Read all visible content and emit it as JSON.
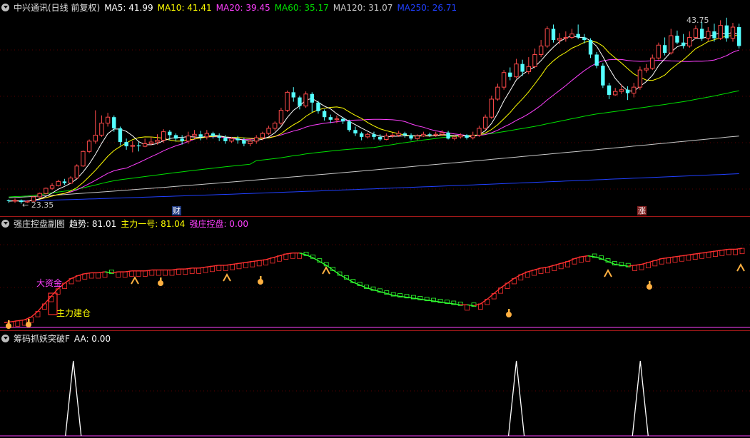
{
  "colors": {
    "up": "#ff4a4a",
    "down": "#54ffff",
    "ma5": "#ffffff",
    "ma10": "#ffff00",
    "ma20": "#ff40ff",
    "ma60": "#00e000",
    "ma120": "#c8c8c8",
    "ma250": "#2040ff",
    "grid": "#5a0000"
  },
  "main": {
    "title": "中兴通讯(日线 前复权)",
    "ma5": "MA5: 41.99",
    "ma10": "MA10: 41.41",
    "ma20": "MA20: 39.45",
    "ma60": "MA60: 35.17",
    "ma120": "MA120: 31.07",
    "ma250": "MA250: 26.71",
    "high_label": "43.75",
    "low_label": "← 23.35",
    "marker_cai": "财",
    "marker_zhang": "涨"
  },
  "sub1": {
    "title": "强庄控盘副图",
    "trend": "趋势: 81.01",
    "main1": "主力一号: 81.04",
    "control": "强庄控盘: 0.00",
    "big_funds": "大资金",
    "build": "主力建仓"
  },
  "sub2": {
    "title": "筹码抓妖突破F",
    "aa": "AA: 0.00"
  },
  "chart_data": [
    {
      "type": "candlestick",
      "title": "中兴通讯(日线 前复权)",
      "candles": [
        [
          23.6,
          23.5,
          23.7,
          23.3
        ],
        [
          23.5,
          23.6,
          23.8,
          23.3
        ],
        [
          23.6,
          23.4,
          23.7,
          23.2
        ],
        [
          23.4,
          23.5,
          23.6,
          23.3
        ],
        [
          23.5,
          24.0,
          24.1,
          23.4
        ],
        [
          24.0,
          24.4,
          24.5,
          23.9
        ],
        [
          24.4,
          25.0,
          25.1,
          24.3
        ],
        [
          25.0,
          25.3,
          25.6,
          24.8
        ],
        [
          25.3,
          25.8,
          26.0,
          25.2
        ],
        [
          25.8,
          25.6,
          26.1,
          25.4
        ],
        [
          25.6,
          26.2,
          26.4,
          25.5
        ],
        [
          26.2,
          27.6,
          27.8,
          26.1
        ],
        [
          27.6,
          29.3,
          29.4,
          27.5
        ],
        [
          29.3,
          30.5,
          30.7,
          29.1
        ],
        [
          30.5,
          31.2,
          34.1,
          30.2
        ],
        [
          31.2,
          32.6,
          33.5,
          31.0
        ],
        [
          32.6,
          33.3,
          33.8,
          32.2
        ],
        [
          33.3,
          32.0,
          33.5,
          31.6
        ],
        [
          32.0,
          30.4,
          32.2,
          30.0
        ],
        [
          30.4,
          29.9,
          30.8,
          29.5
        ],
        [
          29.9,
          30.0,
          30.5,
          29.2
        ],
        [
          30.0,
          29.9,
          30.4,
          29.3
        ],
        [
          29.9,
          30.2,
          30.8,
          29.8
        ],
        [
          30.2,
          30.4,
          31.0,
          30.0
        ],
        [
          30.4,
          30.6,
          31.3,
          30.1
        ],
        [
          30.6,
          31.6,
          31.9,
          30.3
        ],
        [
          31.6,
          31.2,
          31.8,
          30.6
        ],
        [
          31.2,
          30.8,
          31.4,
          30.5
        ],
        [
          30.8,
          30.5,
          31.2,
          30.1
        ],
        [
          30.5,
          31.1,
          31.6,
          30.2
        ],
        [
          31.1,
          31.3,
          31.8,
          30.8
        ],
        [
          31.3,
          31.0,
          31.7,
          30.6
        ],
        [
          31.0,
          31.4,
          31.8,
          30.7
        ],
        [
          31.4,
          31.1,
          31.6,
          30.8
        ],
        [
          31.1,
          30.9,
          31.4,
          30.5
        ],
        [
          30.9,
          30.5,
          31.2,
          30.2
        ],
        [
          30.5,
          30.8,
          31.0,
          30.3
        ],
        [
          30.8,
          30.6,
          31.1,
          30.2
        ],
        [
          30.6,
          30.2,
          30.9,
          29.9
        ],
        [
          30.2,
          30.5,
          30.8,
          29.9
        ],
        [
          30.5,
          30.9,
          31.2,
          30.2
        ],
        [
          30.9,
          31.4,
          31.6,
          30.6
        ],
        [
          31.4,
          32.0,
          32.3,
          31.2
        ],
        [
          32.0,
          32.6,
          32.8,
          31.7
        ],
        [
          32.6,
          34.1,
          34.4,
          32.4
        ],
        [
          34.1,
          36.2,
          36.4,
          33.9
        ],
        [
          36.2,
          35.6,
          36.8,
          35.1
        ],
        [
          35.6,
          34.6,
          35.8,
          34.2
        ],
        [
          34.6,
          36.0,
          36.3,
          34.4
        ],
        [
          36.0,
          35.0,
          36.2,
          33.9
        ],
        [
          35.0,
          34.0,
          35.2,
          33.7
        ],
        [
          34.0,
          33.3,
          34.2,
          32.9
        ],
        [
          33.3,
          33.0,
          33.6,
          32.6
        ],
        [
          33.0,
          33.1,
          33.5,
          32.6
        ],
        [
          33.1,
          32.8,
          33.3,
          32.5
        ],
        [
          32.8,
          31.8,
          33.0,
          31.6
        ],
        [
          31.8,
          31.4,
          32.2,
          31.1
        ],
        [
          31.4,
          31.0,
          31.6,
          30.6
        ],
        [
          31.0,
          31.3,
          31.5,
          30.8
        ],
        [
          31.3,
          31.0,
          31.6,
          30.7
        ],
        [
          31.0,
          30.7,
          31.3,
          30.5
        ],
        [
          30.7,
          31.1,
          31.4,
          30.6
        ],
        [
          31.1,
          31.2,
          31.5,
          30.9
        ],
        [
          31.2,
          31.4,
          31.7,
          31.0
        ],
        [
          31.4,
          31.2,
          31.6,
          30.9
        ],
        [
          31.2,
          30.8,
          31.4,
          30.6
        ],
        [
          30.8,
          31.1,
          31.3,
          30.6
        ],
        [
          31.1,
          31.3,
          31.6,
          31.0
        ],
        [
          31.3,
          31.2,
          31.5,
          31.0
        ],
        [
          31.2,
          31.3,
          31.6,
          31.0
        ],
        [
          31.3,
          31.5,
          31.8,
          31.1
        ],
        [
          31.5,
          30.8,
          31.7,
          30.7
        ],
        [
          30.8,
          31.0,
          31.2,
          30.6
        ],
        [
          31.0,
          31.2,
          31.4,
          30.8
        ],
        [
          31.2,
          30.9,
          31.3,
          30.7
        ],
        [
          30.9,
          31.2,
          31.6,
          30.7
        ],
        [
          31.2,
          32.0,
          32.3,
          31.0
        ],
        [
          32.0,
          33.3,
          33.6,
          31.8
        ],
        [
          33.3,
          35.4,
          35.8,
          33.1
        ],
        [
          35.4,
          36.8,
          37.2,
          35.2
        ],
        [
          36.8,
          38.5,
          38.8,
          36.5
        ],
        [
          38.5,
          38.0,
          39.1,
          37.6
        ],
        [
          38.0,
          39.5,
          40.1,
          37.8
        ],
        [
          39.5,
          38.6,
          40.0,
          38.1
        ],
        [
          38.6,
          39.2,
          40.3,
          38.3
        ],
        [
          39.2,
          40.6,
          41.3,
          39.0
        ],
        [
          40.6,
          41.6,
          42.3,
          40.3
        ],
        [
          41.6,
          43.6,
          43.9,
          41.4
        ],
        [
          43.6,
          42.3,
          44.1,
          42.0
        ],
        [
          42.3,
          42.5,
          43.1,
          41.8
        ],
        [
          42.5,
          42.6,
          43.3,
          42.1
        ],
        [
          42.6,
          43.0,
          43.6,
          42.4
        ],
        [
          43.0,
          42.6,
          44.1,
          42.4
        ],
        [
          42.6,
          42.3,
          43.0,
          41.9
        ],
        [
          42.3,
          40.6,
          42.5,
          40.2
        ],
        [
          40.6,
          39.3,
          40.9,
          39.0
        ],
        [
          39.3,
          37.0,
          39.6,
          36.7
        ],
        [
          37.0,
          35.9,
          37.3,
          35.4
        ],
        [
          35.9,
          36.3,
          36.7,
          35.8
        ],
        [
          36.3,
          36.5,
          37.1,
          36.0
        ],
        [
          36.5,
          36.1,
          36.9,
          35.3
        ],
        [
          36.1,
          36.8,
          37.3,
          35.6
        ],
        [
          36.8,
          38.8,
          39.2,
          36.5
        ],
        [
          38.8,
          39.0,
          39.5,
          38.5
        ],
        [
          39.0,
          40.2,
          40.6,
          38.8
        ],
        [
          40.2,
          41.7,
          42.0,
          40.0
        ],
        [
          41.7,
          40.8,
          42.6,
          40.5
        ],
        [
          40.8,
          42.8,
          43.6,
          40.6
        ],
        [
          42.8,
          42.0,
          43.4,
          41.8
        ],
        [
          42.0,
          41.6,
          43.0,
          41.3
        ],
        [
          41.6,
          42.6,
          43.3,
          41.4
        ],
        [
          42.6,
          43.6,
          44.0,
          42.4
        ],
        [
          43.6,
          42.5,
          44.4,
          42.2
        ],
        [
          42.5,
          43.3,
          43.8,
          42.2
        ],
        [
          43.3,
          42.5,
          44.2,
          42.1
        ],
        [
          42.5,
          44.0,
          44.6,
          42.3
        ],
        [
          44.0,
          42.5,
          44.9,
          42.1
        ],
        [
          42.5,
          43.8,
          44.3,
          42.1
        ],
        [
          43.8,
          41.6,
          44.2,
          41.3
        ]
      ],
      "ylim": [
        23.0,
        45.3
      ]
    },
    {
      "type": "line",
      "title": "强庄控盘副图",
      "series": [
        {
          "name": "主力一号",
          "values": [
            2,
            3,
            4,
            5,
            8,
            14,
            22,
            30,
            38,
            44,
            49,
            52,
            54,
            55,
            55,
            56,
            55,
            56,
            56,
            57,
            57,
            57,
            58,
            58,
            58,
            58,
            59,
            59,
            60,
            60,
            61,
            62,
            63,
            63,
            64,
            65,
            66,
            67,
            68,
            69,
            71,
            73,
            75,
            76,
            76,
            74,
            71,
            67,
            63,
            58,
            53,
            49,
            45,
            42,
            39,
            37,
            35,
            33,
            31,
            30,
            29,
            28,
            27,
            26,
            25,
            24,
            23,
            22,
            21,
            21,
            20,
            22,
            27,
            33,
            39,
            44,
            49,
            53,
            56,
            58,
            60,
            61,
            63,
            65,
            67,
            70,
            72,
            73,
            72,
            70,
            67,
            64,
            63,
            62,
            63,
            64,
            66,
            68,
            70,
            71,
            72,
            73,
            74,
            75,
            76,
            77,
            78,
            79,
            80,
            80,
            81
          ]
        }
      ],
      "ylim": [
        0,
        100
      ]
    },
    {
      "type": "line",
      "title": "筹码抓妖突破F",
      "series": [
        {
          "name": "AA",
          "values": [
            0,
            0,
            0,
            0,
            0,
            0,
            0,
            0,
            0,
            0,
            0,
            0,
            0,
            0,
            0,
            0,
            0,
            0,
            0,
            0,
            0,
            0,
            0,
            0,
            0,
            0,
            0,
            0,
            0,
            0,
            0,
            0,
            0,
            0,
            0,
            0,
            0,
            0,
            0,
            0,
            0,
            0,
            0,
            0,
            0,
            0,
            0,
            0,
            0,
            0,
            0,
            0,
            0,
            0,
            0,
            0,
            0,
            0,
            0,
            0,
            0,
            0,
            0,
            0,
            0,
            0,
            0,
            0,
            0,
            0,
            0,
            0,
            0,
            0,
            0,
            0,
            0,
            0,
            0,
            0,
            0,
            0,
            0,
            0,
            0,
            0,
            0,
            0,
            0,
            0,
            0,
            0,
            0,
            0,
            0,
            0,
            0,
            0,
            0,
            0,
            0,
            0,
            0,
            0,
            0,
            0,
            0,
            0,
            0,
            0,
            0
          ]
        }
      ],
      "spikes": [
        {
          "pos": 0.093,
          "value": 1
        },
        {
          "pos": 0.69,
          "value": 1
        },
        {
          "pos": 0.857,
          "value": 1
        }
      ],
      "ylim": [
        0,
        1.2
      ]
    }
  ]
}
